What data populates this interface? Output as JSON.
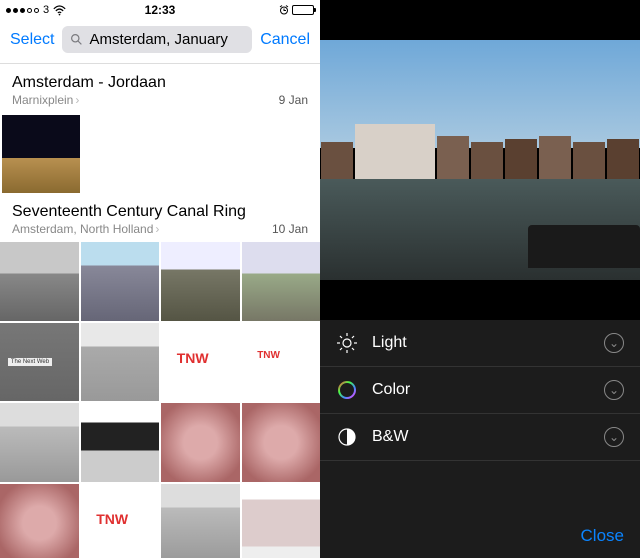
{
  "status_bar": {
    "carrier": "3",
    "time": "12:33",
    "battery_icon": "battery-icon",
    "wifi_icon": "wifi-icon",
    "alarm_icon": "alarm-icon"
  },
  "left_pane": {
    "select_label": "Select",
    "cancel_label": "Cancel",
    "search_value": "Amsterdam, January",
    "search_icon": "search-icon",
    "sections": [
      {
        "title": "Amsterdam - Jordaan",
        "subtitle": "Marnixplein",
        "date": "9 Jan",
        "thumb_count": 1
      },
      {
        "title": "Seventeenth Century Canal Ring",
        "subtitle": "Amsterdam, North Holland",
        "date": "10 Jan",
        "thumb_count": 16
      }
    ]
  },
  "right_pane": {
    "adjustments": [
      {
        "icon": "brightness-icon",
        "label": "Light"
      },
      {
        "icon": "color-ring-icon",
        "label": "Color"
      },
      {
        "icon": "bw-contrast-icon",
        "label": "B&W"
      }
    ],
    "close_label": "Close",
    "expand_icon": "chevron-down-icon"
  },
  "colors": {
    "ios_blue": "#007aff",
    "ios_blue_dark": "#0a84ff"
  }
}
